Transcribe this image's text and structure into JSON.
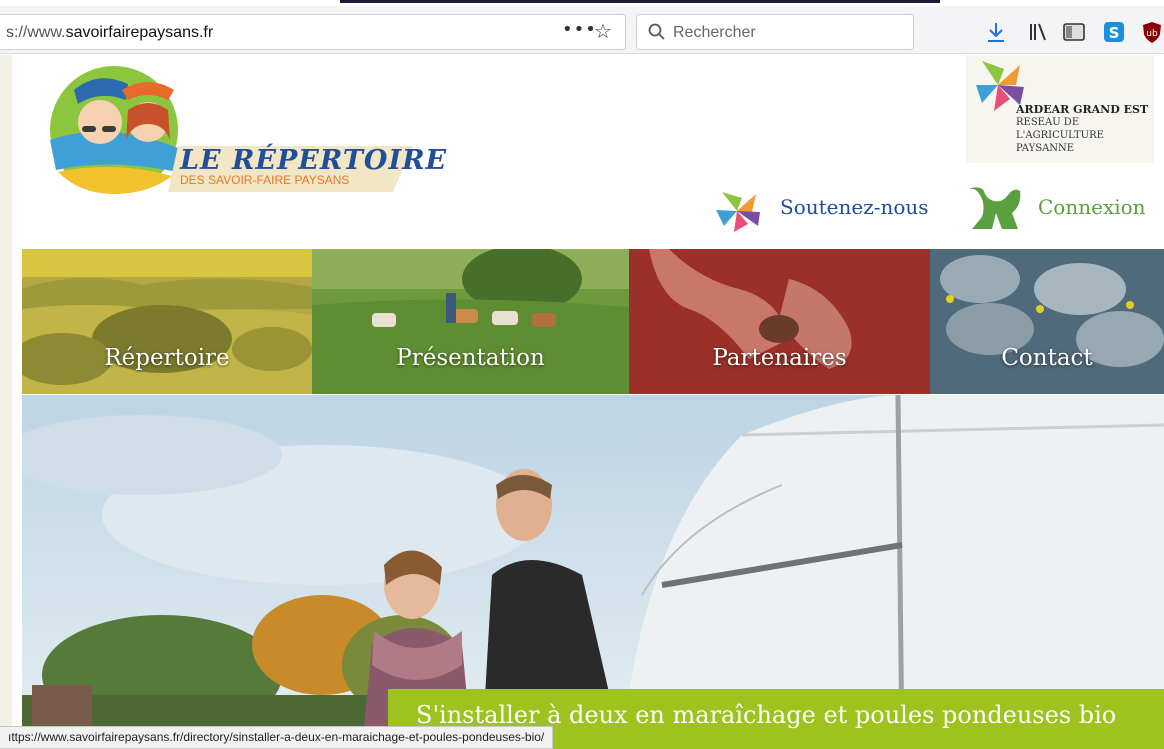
{
  "browser": {
    "url_prefix": "s://www.",
    "url_domain": "savoirfairepaysans.fr",
    "more_label": "•••",
    "search_placeholder": "Rechercher",
    "status_url": "ıttps://www.savoirfairepaysans.fr/directory/sinstaller-a-deux-en-maraichage-et-poules-pondeuses-bio/"
  },
  "header": {
    "logo_title": "LE RÉPERTOIRE",
    "logo_subtitle": "DES SAVOIR-FAIRE PAYSANS",
    "ardear": {
      "name": "ARDEAR GRAND EST",
      "lines": [
        "RESEAU DE",
        "L'AGRICULTURE",
        "PAYSANNE"
      ]
    },
    "support_label": "Soutenez-nous",
    "login_label": "Connexion"
  },
  "nav": {
    "items": [
      {
        "label": "Répertoire"
      },
      {
        "label": "Présentation"
      },
      {
        "label": "Partenaires"
      },
      {
        "label": "Contact"
      }
    ]
  },
  "hero": {
    "caption": "S'installer à deux en maraîchage et poules pondeuses bio"
  },
  "colors": {
    "brand_blue": "#1f4e9a",
    "brand_green": "#5aa040",
    "caption_green": "#9ec31f",
    "logo_orange": "#e07a2a"
  }
}
